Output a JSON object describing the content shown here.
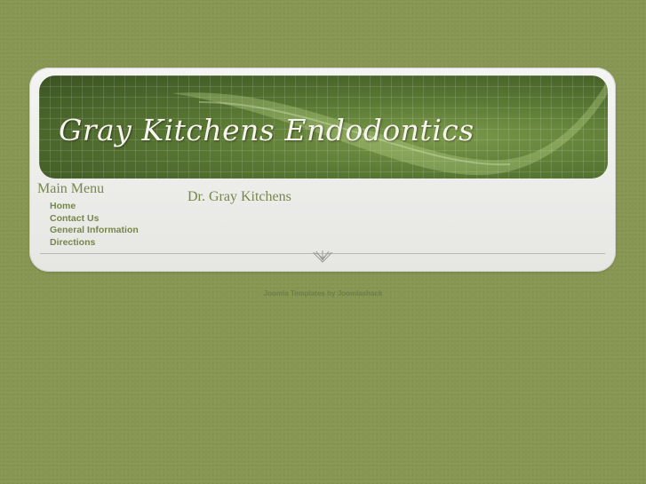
{
  "header": {
    "site_title": "Gray Kitchens Endodontics"
  },
  "sidebar": {
    "menu_title": "Main Menu",
    "items": [
      {
        "label": "Home"
      },
      {
        "label": "Contact Us"
      },
      {
        "label": "General Information"
      },
      {
        "label": "Directions"
      }
    ]
  },
  "main": {
    "title": "Dr. Gray Kitchens"
  },
  "footer": {
    "credit_link": "Joomla Templates by Joomlashack"
  },
  "colors": {
    "background": "#879652",
    "accent_text": "#76874a",
    "panel": "#efefec"
  }
}
